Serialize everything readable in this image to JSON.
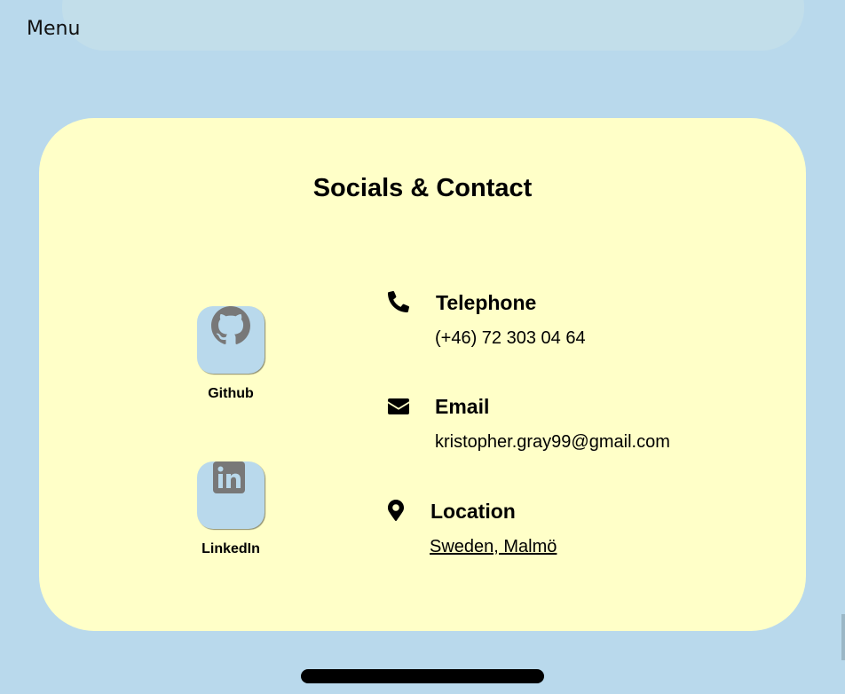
{
  "nav": {
    "menu_label": "Menu"
  },
  "section": {
    "title": "Socials & Contact"
  },
  "socials": [
    {
      "label": "Github",
      "icon": "github-icon"
    },
    {
      "label": "LinkedIn",
      "icon": "linkedin-icon"
    }
  ],
  "contact": {
    "telephone": {
      "heading": "Telephone",
      "value": "(+46) 72 303 04 64",
      "icon": "phone-icon"
    },
    "email": {
      "heading": "Email",
      "value": "kristopher.gray99@gmail.com",
      "icon": "envelope-icon"
    },
    "location": {
      "heading": "Location",
      "value": "Sweden, Malmö",
      "icon": "map-pin-icon"
    }
  },
  "colors": {
    "page_background": "#b9d9ec",
    "card_background": "#ffffc8",
    "social_button": "#b9d9ec",
    "social_icon": "#787878",
    "text": "#000000"
  }
}
